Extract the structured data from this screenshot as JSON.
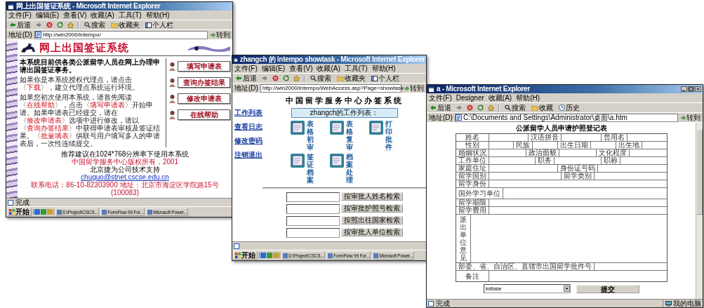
{
  "windows": [
    {
      "kind": "visa_portal",
      "title": "网上出国签证系统 - Microsoft Internet Explorer",
      "menu": [
        "文件(F)",
        "编辑(E)",
        "查看(V)",
        "收藏(A)",
        "工具(T)",
        "帮助(H)"
      ],
      "toolbar": [
        {
          "kind": "back",
          "label": "后退"
        },
        {
          "kind": "search",
          "label": "搜索"
        },
        {
          "kind": "favorites",
          "label": "收藏夹"
        },
        {
          "kind": "personal",
          "label": "个人栏"
        }
      ],
      "address_label": "地址(D)",
      "address": "http://win2000/intempo/",
      "go": "转到",
      "status": "完成",
      "taskbar": {
        "start": "开始",
        "items": [
          "D:\\Project\\CSCS...",
          "FormFlow 99 For...",
          "Microsoft Power..."
        ]
      },
      "page": {
        "banner": "网上出国签证系统",
        "paragraphs": [
          {
            "kind": "lead",
            "parts": [
              {
                "text": "本系统目前供各类公派留学人员在网上办理申请出国签证事务。",
                "kind": "text"
              }
            ]
          },
          {
            "kind": "body",
            "parts": [
              {
                "text": "如果你是本系统授权代理点，请点击〈",
                "kind": "text"
              },
              {
                "text": "下载",
                "kind": "link"
              },
              {
                "text": "〉，建立代理点系统运行环境。",
                "kind": "text"
              }
            ]
          },
          {
            "kind": "body",
            "parts": [
              {
                "text": "如果您初次使用本系统，请首先阅读〈",
                "kind": "text"
              },
              {
                "text": "在线帮助",
                "kind": "link"
              },
              {
                "text": "〉，点击〈",
                "kind": "text"
              },
              {
                "text": "填写申请表",
                "kind": "link"
              },
              {
                "text": "〉开始申请。如果申请表已经提交，请在〈",
                "kind": "text"
              },
              {
                "text": "修改申请表",
                "kind": "link"
              },
              {
                "text": "〉选项中进行修改，请以〈",
                "kind": "text"
              },
              {
                "text": "查询办签结果",
                "kind": "link"
              },
              {
                "text": "〉中获得申请表审核及签证结果。〈",
                "kind": "text"
              },
              {
                "text": "批量填表",
                "kind": "link"
              },
              {
                "text": "〉供联号用户填写多人的申请表后，一次性连续提交。",
                "kind": "text"
              }
            ]
          }
        ],
        "buttons": [
          "填写申请表",
          "查询办签结果",
          "修改申请表",
          "在线帮助"
        ],
        "footer": [
          {
            "kind": "note",
            "text": "推荐建议在1024*768分辨率下使用本系统"
          },
          {
            "kind": "notice",
            "text": "中国留学服务中心版权所有，2001"
          },
          {
            "kind": "plain",
            "text": "北京捷为公司技术支持"
          },
          {
            "kind": "email",
            "text": "chuguo@stnet.cscse.edu.cn"
          },
          {
            "kind": "contact",
            "text": "联系电话：86-10-82303900 地址：北京市海淀区学院路15号(100083)"
          }
        ]
      }
    },
    {
      "kind": "task_list",
      "title": "zhangch 的 intempo showtask - Microsoft Internet Explorer",
      "menu": [
        "文件(F)",
        "编辑(E)",
        "查看(V)",
        "收藏(A)",
        "工具(T)",
        "帮助(H)"
      ],
      "toolbar": [
        {
          "kind": "back",
          "label": "后退"
        },
        {
          "kind": "search",
          "label": "搜索"
        },
        {
          "kind": "favorites",
          "label": "收藏夹"
        },
        {
          "kind": "personal",
          "label": "个人栏"
        }
      ],
      "address_label": "地址(D)",
      "address": "http://win2000/intempo/WebAccess.asp?Page=showtask",
      "go": "转到",
      "taskbar": {
        "start": "开始",
        "items": [
          "D:\\Project\\CSCS...",
          "FormFlow 99 For...",
          "Microsoft Power..."
        ]
      },
      "page": {
        "title": "中国留学服务中心办签系统",
        "sidebar": [
          "工作列表",
          "查看日志",
          "修改密码",
          "注销退出"
        ],
        "worklist": "zhangch的工作列表：",
        "tasks": [
          "表格初审",
          "表格复审",
          "打印批件",
          "签证档案",
          "档案处理"
        ],
        "searches": [
          "按审批人姓名检索",
          "按审批护照号检索",
          "按照出往国家检索",
          "按审批人单位检索"
        ]
      }
    },
    {
      "kind": "form",
      "title": "a - Microsoft Internet Explorer",
      "menu": [
        "文件(F)",
        "Designer",
        "收藏(A)",
        "帮助(H)"
      ],
      "toolbar": [
        {
          "kind": "back",
          "label": "后退"
        },
        {
          "kind": "search",
          "label": "搜索"
        },
        {
          "kind": "favorites",
          "label": "收藏"
        },
        {
          "kind": "history",
          "label": "历史"
        }
      ],
      "address_label": "地址(D)",
      "address": "C:\\Documents and Settings\\Administrator\\桌面\\a.htm",
      "go": "转到",
      "status": "完成",
      "zone": "我的电脑",
      "page": {
        "title": "公派留学人员申请护照登记表",
        "rows": [
          {
            "kind": "fields",
            "labels": [
              "姓名",
              "汉语拼音",
              "曾用名"
            ]
          },
          {
            "kind": "fields",
            "labels": [
              "性别",
              "民族",
              "出生日期",
              "出生地"
            ]
          },
          {
            "kind": "fields",
            "labels": [
              "婚姻状况",
              "政治面貌",
              "文化程度"
            ]
          },
          {
            "kind": "fields",
            "labels": [
              "工作单位",
              "职务",
              "职称"
            ]
          },
          {
            "kind": "fields",
            "labels": [
              "家庭住址",
              "身份证号码"
            ]
          },
          {
            "kind": "fields",
            "labels": [
              "留学国别",
              "留学类别"
            ]
          },
          {
            "kind": "fields",
            "labels": [
              "留学身份"
            ]
          },
          {
            "kind": "tall",
            "labels": [
              "国外学习单位"
            ]
          },
          {
            "kind": "fields",
            "labels": [
              "留学期限"
            ]
          },
          {
            "kind": "fields",
            "labels": [
              "留学费用"
            ]
          },
          {
            "kind": "vertical",
            "labels": [
              "派出单位意见"
            ]
          },
          {
            "kind": "fields",
            "labels": [
              "部委、省、自治区、直辖市出国留学批件号"
            ]
          },
          {
            "kind": "tall",
            "labels": [
              "备注"
            ]
          }
        ],
        "action": "initiate",
        "submit": "提交"
      }
    }
  ]
}
